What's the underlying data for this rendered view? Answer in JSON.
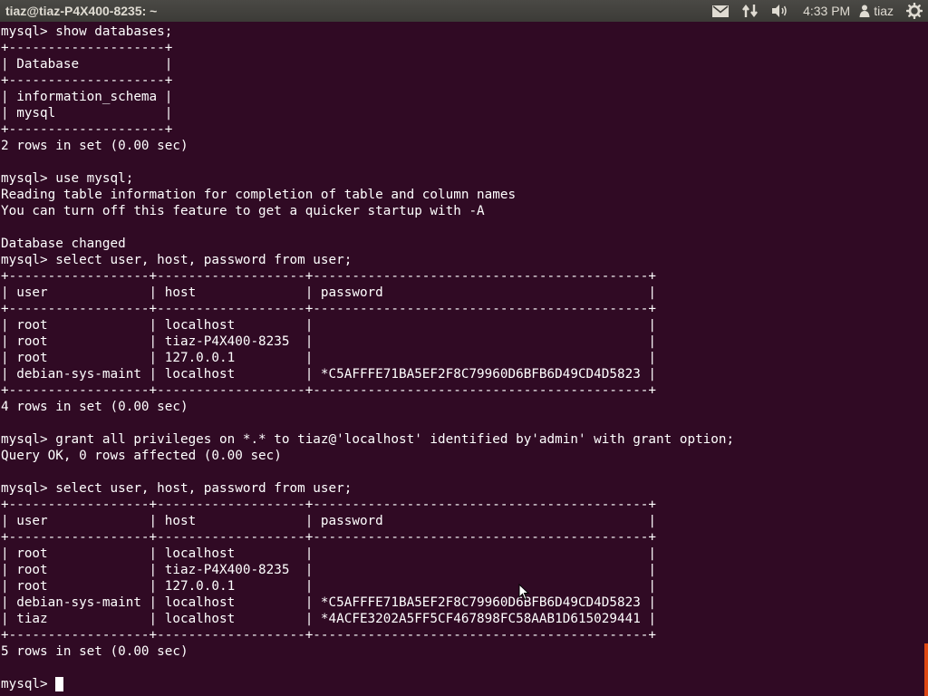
{
  "topbar": {
    "title": "tiaz@tiaz-P4X400-8235: ~",
    "clock": "4:33 PM",
    "user": "tiaz",
    "icons": [
      "mail-icon",
      "network-icon",
      "volume-icon",
      "user-icon",
      "power-icon"
    ]
  },
  "terminal": {
    "lines": [
      "mysql> show databases;",
      "+--------------------+",
      "| Database           |",
      "+--------------------+",
      "| information_schema |",
      "| mysql              |",
      "+--------------------+",
      "2 rows in set (0.00 sec)",
      "",
      "mysql> use mysql;",
      "Reading table information for completion of table and column names",
      "You can turn off this feature to get a quicker startup with -A",
      "",
      "Database changed",
      "mysql> select user, host, password from user;",
      "+------------------+-------------------+-------------------------------------------+",
      "| user             | host              | password                                  |",
      "+------------------+-------------------+-------------------------------------------+",
      "| root             | localhost         |                                           |",
      "| root             | tiaz-P4X400-8235  |                                           |",
      "| root             | 127.0.0.1         |                                           |",
      "| debian-sys-maint | localhost         | *C5AFFFE71BA5EF2F8C79960D6BFB6D49CD4D5823 |",
      "+------------------+-------------------+-------------------------------------------+",
      "4 rows in set (0.00 sec)",
      "",
      "mysql> grant all privileges on *.* to tiaz@'localhost' identified by'admin' with grant option;",
      "Query OK, 0 rows affected (0.00 sec)",
      "",
      "mysql> select user, host, password from user;",
      "+------------------+-------------------+-------------------------------------------+",
      "| user             | host              | password                                  |",
      "+------------------+-------------------+-------------------------------------------+",
      "| root             | localhost         |                                           |",
      "| root             | tiaz-P4X400-8235  |                                           |",
      "| root             | 127.0.0.1         |                                           |",
      "| debian-sys-maint | localhost         | *C5AFFFE71BA5EF2F8C79960D6BFB6D49CD4D5823 |",
      "| tiaz             | localhost         | *4ACFE3202A5FF5CF467898FC58AAB1D615029441 |",
      "+------------------+-------------------+-------------------------------------------+",
      "5 rows in set (0.00 sec)",
      ""
    ],
    "prompt": "mysql> "
  },
  "colors": {
    "background": "#300a24",
    "text": "#ffffff",
    "panel": "#3c3b37",
    "scroll_accent": "#dd4814"
  }
}
